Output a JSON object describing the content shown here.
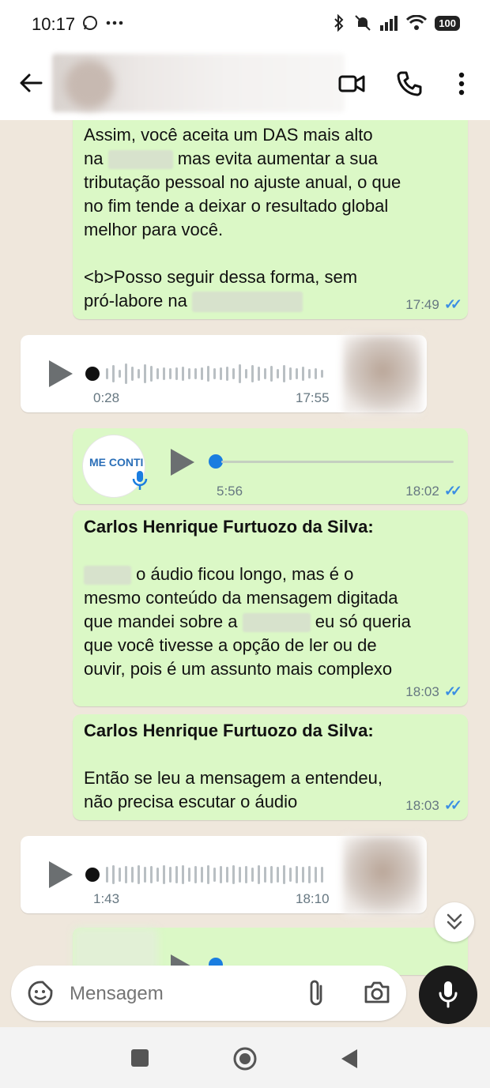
{
  "status_bar": {
    "time": "10:17",
    "battery": "100"
  },
  "header": {
    "contact_name": ""
  },
  "messages": {
    "m1": {
      "lines": [
        "Assim, você aceita um DAS mais alto",
        "mas evita aumentar a sua",
        "tributação pessoal no ajuste anual, o que",
        "no fim tende a deixar o resultado global",
        "melhor para você."
      ],
      "line2_prefix": "na",
      "line6": "<b>Posso seguir dessa forma, sem",
      "line7": "pró-labore na",
      "time": "17:49"
    },
    "a1": {
      "duration": "0:28",
      "time": "17:55"
    },
    "a2": {
      "duration": "5:56",
      "time": "18:02",
      "avatar_label": "ME CONTI"
    },
    "m2": {
      "sender": "Carlos Henrique Furtuozo da Silva:",
      "line1": "o áudio ficou longo, mas é o",
      "line2": "mesmo conteúdo da mensagem digitada",
      "line3a": "que mandei sobre a",
      "line3b": "eu só queria",
      "line4": "que você tivesse a opção de ler ou de",
      "line5": "ouvir, pois é um assunto mais complexo",
      "time": "18:03"
    },
    "m3": {
      "sender": "Carlos Henrique Furtuozo da Silva:",
      "line1": "Então se leu a mensagem a entendeu,",
      "line2": "não precisa escutar o áudio",
      "time": "18:03"
    },
    "a3": {
      "duration": "1:43",
      "time": "18:10"
    }
  },
  "input": {
    "placeholder": "Mensagem"
  },
  "colors": {
    "outgoing": "#dbf8c6",
    "incoming": "#ffffff",
    "ticks": "#3b8ee3",
    "audio_dot_out": "#1a7de0",
    "audio_dot_in": "#111111"
  }
}
